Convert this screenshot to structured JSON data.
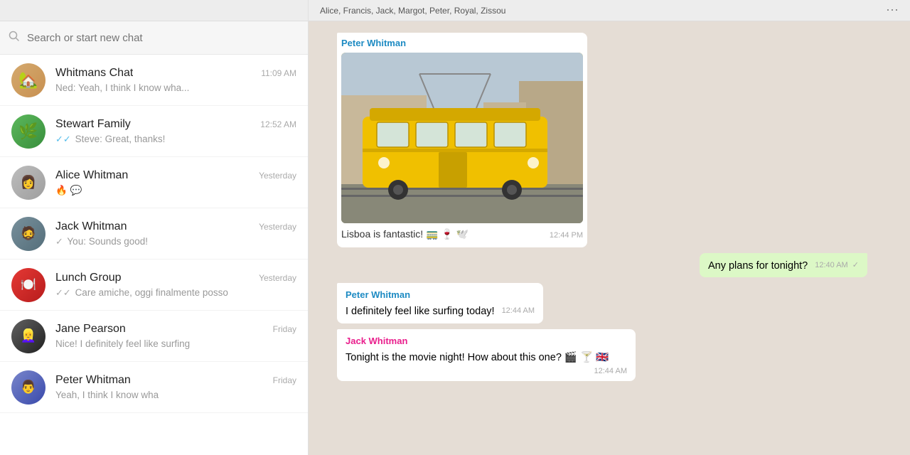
{
  "sidebar": {
    "search_placeholder": "Search or start new chat",
    "chats": [
      {
        "id": "whitmans-chat",
        "name": "Whitmans Chat",
        "time": "11:09 AM",
        "preview": "Ned: Yeah, I think I know wha...",
        "tick": "double-blue",
        "avatar_color": "#c8a96e",
        "avatar_emoji": "🏡"
      },
      {
        "id": "stewart-family",
        "name": "Stewart Family",
        "time": "12:52 AM",
        "preview": "Steve: Great, thanks!",
        "tick": "double-blue",
        "avatar_color": "#4caf50",
        "avatar_emoji": "🌿"
      },
      {
        "id": "alice-whitman",
        "name": "Alice Whitman",
        "time": "Yesterday",
        "preview": "🔥 💬",
        "tick": "none",
        "avatar_color": "#9e9e9e",
        "avatar_emoji": "👩"
      },
      {
        "id": "jack-whitman",
        "name": "Jack Whitman",
        "time": "Yesterday",
        "preview": "You: Sounds good!",
        "tick": "single-gray",
        "avatar_color": "#607d8b",
        "avatar_emoji": "🧔"
      },
      {
        "id": "lunch-group",
        "name": "Lunch Group",
        "time": "Yesterday",
        "preview": "Care amiche, oggi finalmente posso",
        "tick": "double-gray",
        "avatar_color": "#c62828",
        "avatar_emoji": "🍽️"
      },
      {
        "id": "jane-pearson",
        "name": "Jane Pearson",
        "time": "Friday",
        "preview": "Nice! I definitely feel like surfing",
        "tick": "none",
        "avatar_color": "#424242",
        "avatar_emoji": "👱‍♀️"
      },
      {
        "id": "peter-whitman",
        "name": "Peter Whitman",
        "time": "Friday",
        "preview": "Yeah, I think I know wha",
        "tick": "none",
        "avatar_color": "#5c6bc0",
        "avatar_emoji": "👨"
      }
    ]
  },
  "header": {
    "group_members": "Alice, Francis, Jack, Margot, Peter, Royal, Zissou"
  },
  "messages": [
    {
      "id": "msg1",
      "type": "incoming",
      "sender": "Peter Whitman",
      "sender_key": "peter",
      "has_image": true,
      "text": "Lisboa is fantastic! 🚃 🍷 🕊️",
      "time": "12:44 PM",
      "tick": "none"
    },
    {
      "id": "msg2",
      "type": "outgoing",
      "sender": "",
      "sender_key": "",
      "has_image": false,
      "text": "Any plans for tonight?",
      "time": "12:40 AM",
      "tick": "single"
    },
    {
      "id": "msg3",
      "type": "incoming",
      "sender": "Peter Whitman",
      "sender_key": "peter",
      "has_image": false,
      "text": "I definitely feel like surfing today!",
      "time": "12:44 AM",
      "tick": "none"
    },
    {
      "id": "msg4",
      "type": "incoming",
      "sender": "Jack Whitman",
      "sender_key": "jack",
      "has_image": false,
      "text": "Tonight is the movie night! How about this one? 🎬 🍸 🇬🇧",
      "time": "12:44 AM",
      "tick": "none"
    }
  ]
}
